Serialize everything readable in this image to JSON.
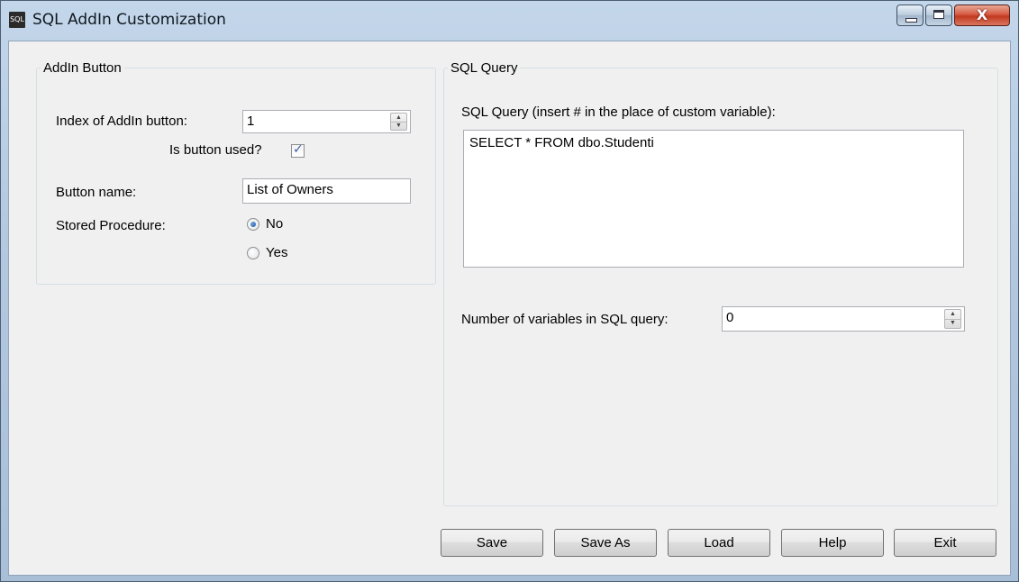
{
  "window": {
    "title": "SQL AddIn Customization",
    "icon_text": "SQL",
    "close_glyph": "X"
  },
  "addin_group": {
    "legend": "AddIn Button",
    "index_label": "Index of AddIn button:",
    "index_value": "1",
    "used_label": "Is button used?",
    "used_checked": true,
    "name_label": "Button name:",
    "name_value": "List of Owners",
    "stored_proc_label": "Stored Procedure:",
    "option_no": "No",
    "option_yes": "Yes",
    "selected_option": "No"
  },
  "sql_group": {
    "legend": "SQL Query",
    "query_label": "SQL Query (insert # in the place of custom variable):",
    "query_text": "SELECT * FROM dbo.Studenti",
    "vars_label": "Number of variables in SQL query:",
    "vars_value": "0"
  },
  "buttons": {
    "save": "Save",
    "save_as": "Save As",
    "load": "Load",
    "help": "Help",
    "exit": "Exit"
  }
}
